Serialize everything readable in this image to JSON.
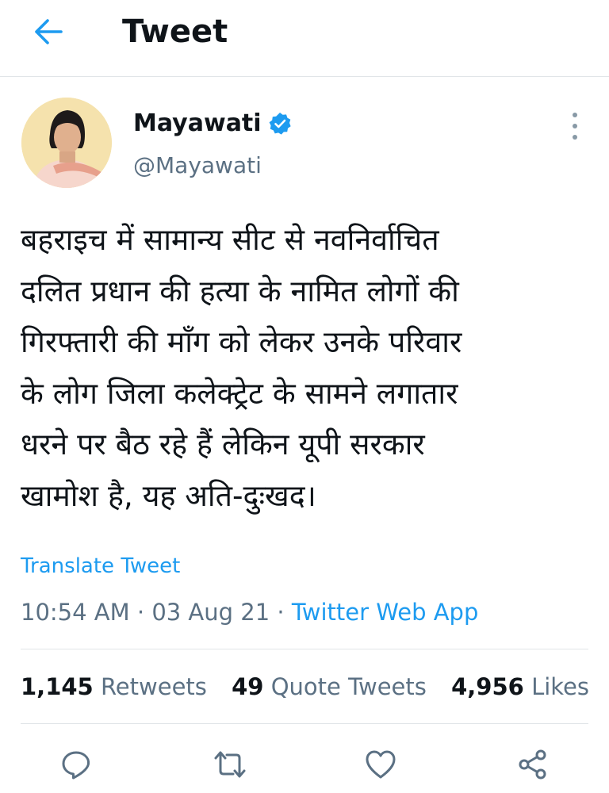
{
  "header": {
    "title": "Tweet",
    "back_icon": "arrow-left-icon"
  },
  "author": {
    "display_name": "Mayawati",
    "handle": "@Mayawati",
    "verified": true
  },
  "tweet": {
    "text": "बहराइच में सामान्य सीट से नवनिर्वाचित\nदलित प्रधान की हत्या के नामित लोगों की\nगिरफ्तारी की माँग को लेकर उनके परिवार\nके लोग जिला कलेक्ट्रेट के सामने लगातार\nधरने पर बैठ रहे हैं लेकिन यूपी सरकार\nखामोश है, यह अति-दुःखद।",
    "translate_label": "Translate Tweet",
    "time": "10:54 AM",
    "date": "03 Aug 21",
    "separator": "·",
    "source": "Twitter Web App"
  },
  "stats": {
    "retweets_count": "1,145",
    "retweets_label": "Retweets",
    "quotes_count": "49",
    "quotes_label": "Quote Tweets",
    "likes_count": "4,956",
    "likes_label": "Likes"
  },
  "actions": [
    "reply-icon",
    "retweet-icon",
    "like-icon",
    "share-icon"
  ],
  "colors": {
    "accent": "#1d9bf0",
    "secondary_text": "#5b7083",
    "icon": "#5b7083",
    "divider": "#e1e5e8"
  }
}
